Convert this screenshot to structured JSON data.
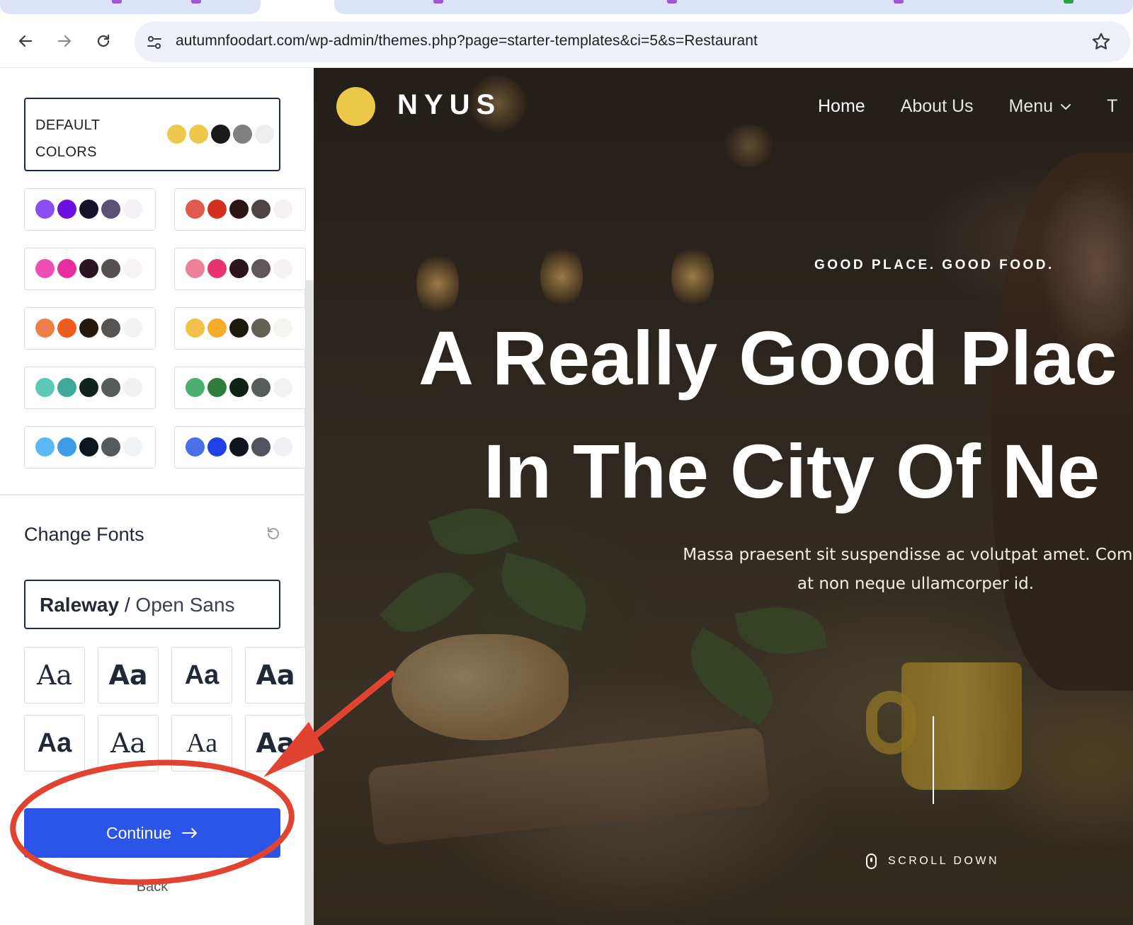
{
  "browser": {
    "url": "autumnfoodart.com/wp-admin/themes.php?page=starter-templates&ci=5&s=Restaurant"
  },
  "sidebar": {
    "default_colors_label": "DEFAULT COLORS",
    "default_palette": [
      "#ecc94b",
      "#ecc94b",
      "#1a1a1a",
      "#808080",
      "#eeeeee"
    ],
    "palettes": [
      [
        "#8b4ef0",
        "#6a11e0",
        "#16122a",
        "#5b5175",
        "#f3f1f6"
      ],
      [
        "#e05a4e",
        "#d1301f",
        "#2a1614",
        "#4d4443",
        "#f6f2f2"
      ],
      [
        "#ee4fb5",
        "#e62e9c",
        "#2a1622",
        "#575053",
        "#f6f2f5"
      ],
      [
        "#ee7f99",
        "#e7336f",
        "#2c151c",
        "#605858",
        "#f6f2f3"
      ],
      [
        "#ef7f4a",
        "#f05a1f",
        "#24180f",
        "#575350",
        "#f4f2f0"
      ],
      [
        "#f1c14b",
        "#f7ab2b",
        "#1f1a10",
        "#656057",
        "#f6f4ef"
      ],
      [
        "#5cc8b6",
        "#3daa98",
        "#10231e",
        "#555b5a",
        "#f0f2f1"
      ],
      [
        "#4caf6f",
        "#2e7d3c",
        "#0f2215",
        "#575d59",
        "#f0f3f1"
      ],
      [
        "#5ab8f2",
        "#3d9be8",
        "#0e1620",
        "#545b5e",
        "#f0f3f5"
      ],
      [
        "#4a6fe8",
        "#1e40e6",
        "#0f1420",
        "#50545e",
        "#f0f1f5"
      ]
    ],
    "fonts_title": "Change Fonts",
    "current_font_primary": "Raleway",
    "current_font_separator": "/",
    "current_font_secondary": "Open Sans",
    "font_samples": [
      "Aa",
      "Aa",
      "Aa",
      "Aa",
      "Aa",
      "Aa",
      "Aa",
      "Aa"
    ],
    "continue_label": "Continue",
    "back_label": "Back",
    "accent_color": "#2b55e6"
  },
  "preview": {
    "logo_text": "NYUS",
    "logo_color": "#ecc94b",
    "nav": [
      "Home",
      "About Us",
      "Menu",
      "T"
    ],
    "tagline": "GOOD PLACE. GOOD FOOD.",
    "hero_line1": "A Really Good Plac",
    "hero_line2": "In The City Of Ne",
    "hero_sub_line1": "Massa praesent sit suspendisse ac volutpat amet. Comm",
    "hero_sub_line2": "at non neque ullamcorper id.",
    "scroll_label": "SCROLL DOWN"
  },
  "annotation": {
    "color": "#e0432f",
    "shapes": [
      "ellipse around Continue button",
      "arrow pointing to Continue button"
    ]
  }
}
